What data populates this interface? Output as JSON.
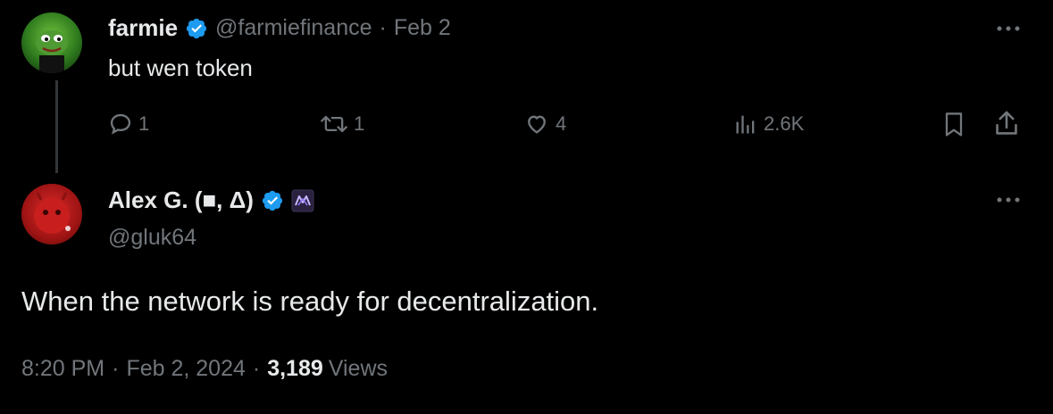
{
  "tweet1": {
    "display_name": "farmie",
    "handle": "@farmiefinance",
    "separator": "·",
    "date": "Feb 2",
    "text": "but wen token",
    "more_icon": "more-horizontal-icon",
    "actions": {
      "reply_count": "1",
      "retweet_count": "1",
      "like_count": "4",
      "views_count": "2.6K"
    }
  },
  "tweet2": {
    "display_name": "Alex G. (■, Δ)",
    "handle": "@gluk64",
    "text": "When the network is ready for decentralization.",
    "time": "8:20 PM",
    "separator1": "·",
    "date": "Feb 2, 2024",
    "separator2": "·",
    "views_count": "3,189",
    "views_label": "Views"
  },
  "colors": {
    "background": "#000000",
    "text": "#e7e9ea",
    "muted": "#71767b",
    "verified": "#1d9bf0"
  }
}
